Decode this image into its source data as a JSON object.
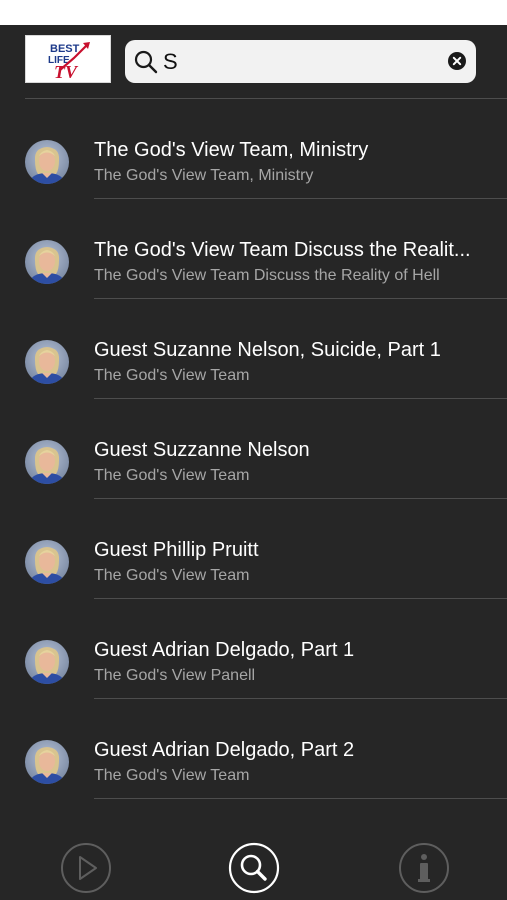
{
  "header": {
    "logo_text": "BEST LIFE TV",
    "search": {
      "value": "S",
      "search_icon": "magnifier-icon",
      "clear_icon": "clear-icon"
    }
  },
  "results": [
    {
      "title": "The God's View Team, Ministry",
      "subtitle": "The God's View Team, Ministry"
    },
    {
      "title": "The God's View Team Discuss the Realit...",
      "subtitle": "The God's View Team Discuss the Reality of Hell"
    },
    {
      "title": "Guest Suzanne Nelson, Suicide, Part 1",
      "subtitle": "The God's View Team"
    },
    {
      "title": "Guest Suzzanne Nelson",
      "subtitle": "The God's View Team"
    },
    {
      "title": "Guest Phillip Pruitt",
      "subtitle": "The God's View Team"
    },
    {
      "title": "Guest Adrian Delgado, Part 1",
      "subtitle": "The God's View Panell"
    },
    {
      "title": "Guest Adrian Delgado, Part 2",
      "subtitle": "The God's View Team"
    }
  ],
  "tabbar": {
    "items": [
      {
        "icon": "play-icon",
        "active": false
      },
      {
        "icon": "search-icon",
        "active": true
      },
      {
        "icon": "info-icon",
        "active": false
      }
    ]
  },
  "colors": {
    "background": "#262626",
    "title_text": "#ffffff",
    "subtitle_text": "#a6a6a6",
    "divider": "#4d4d4d",
    "active_tab": "#ffffff",
    "inactive_tab": "#5e5e5e"
  }
}
